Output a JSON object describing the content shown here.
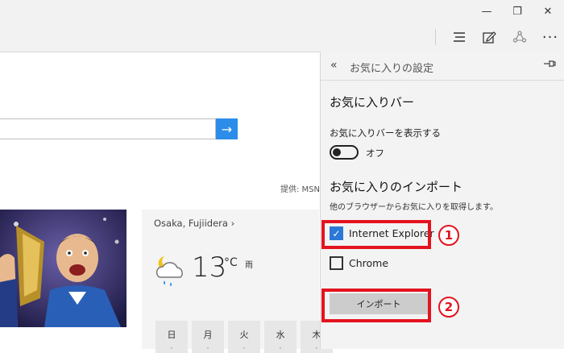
{
  "window": {
    "minimize_glyph": "—",
    "maximize_glyph": "❐",
    "close_glyph": "✕"
  },
  "toolbar": {
    "hub_icon": "hub-icon",
    "web_note_icon": "web-note-icon",
    "share_icon": "share-icon",
    "more_label": "···"
  },
  "page": {
    "search_go_glyph": "→",
    "provided_by": "提供: MSN",
    "weather": {
      "location": "Osaka, Fujiidera ›",
      "temperature": "13",
      "unit": "°C",
      "condition": "雨",
      "days": [
        {
          "label": "日",
          "value": "-"
        },
        {
          "label": "月",
          "value": "-"
        },
        {
          "label": "火",
          "value": "-"
        },
        {
          "label": "水",
          "value": "-"
        },
        {
          "label": "木",
          "value": "-"
        }
      ]
    }
  },
  "panel": {
    "back_glyph": "«",
    "title": "お気に入りの設定",
    "pin_glyph": "⊣",
    "favorites_bar_heading": "お気に入りバー",
    "show_favorites_bar_label": "お気に入りバーを表示する",
    "toggle_state": "オフ",
    "import_heading": "お気に入りのインポート",
    "import_subtext": "他のブラウザーからお気に入りを取得します。",
    "browsers": [
      {
        "label": "Internet Explorer",
        "checked": true
      },
      {
        "label": "Chrome",
        "checked": false
      }
    ],
    "import_button": "インポート"
  },
  "annotations": {
    "badge1": "1",
    "badge2": "2",
    "color": "#e4121e"
  }
}
